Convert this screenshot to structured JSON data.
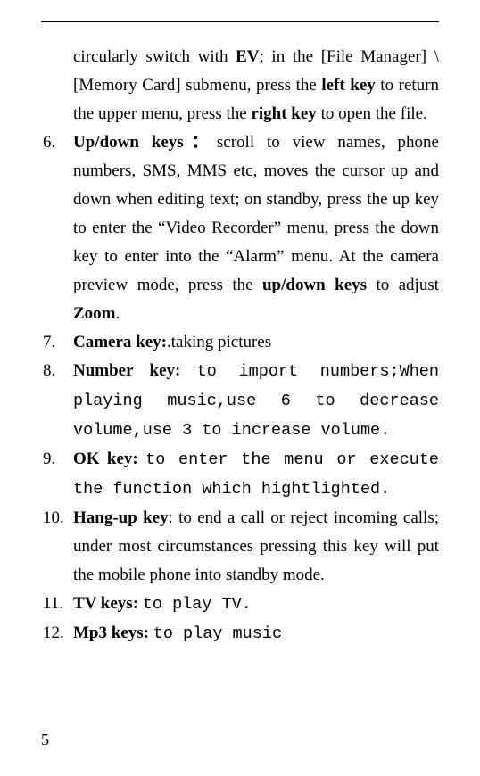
{
  "page_number": "5",
  "lead": {
    "p1a": "circularly switch with ",
    "p1b": "EV",
    "p1c": "; in the [File Manager] \\[Memory Card] submenu, press the ",
    "p1d": "left key",
    "p1e": " to return the upper menu, press the ",
    "p1f": "right key",
    "p1g": " to open the file."
  },
  "items": {
    "i6": {
      "num": "6.",
      "label": "Up/down keys：",
      "t1": "scroll to view names, phone numbers, SMS, MMS etc, moves the cursor up and down when editing text; on standby, press the up key to enter the “Video Recorder” menu, press the down key to enter into the “Alarm” menu. At the camera preview mode, press the ",
      "t2": "up/down keys",
      "t3": " to adjust ",
      "t4": "Zoom",
      "t5": "."
    },
    "i7": {
      "num": "7.",
      "label": "Camera key:",
      "t1": ".taking pictures"
    },
    "i8": {
      "num": "8.",
      "label": "Number key:",
      "sp": " ",
      "m1": "to import numbers;When playing music,use 6 to decrease volume,use 3 to increase volume."
    },
    "i9": {
      "num": "9.",
      "label": "OK key:",
      "sp": " ",
      "m1": "to enter the menu or execute the function which hightlighted."
    },
    "i10": {
      "num": "10.",
      "label": "Hang-up key",
      "t1": ": to end a call or reject incoming calls; under most circumstances pressing this key will put the mobile phone into standby mode."
    },
    "i11": {
      "num": "11.",
      "label": "TV keys:",
      "sp": "  ",
      "m1": "to play TV."
    },
    "i12": {
      "num": "12.",
      "label": "Mp3 keys:",
      "sp": " ",
      "m1": "to play music"
    }
  }
}
